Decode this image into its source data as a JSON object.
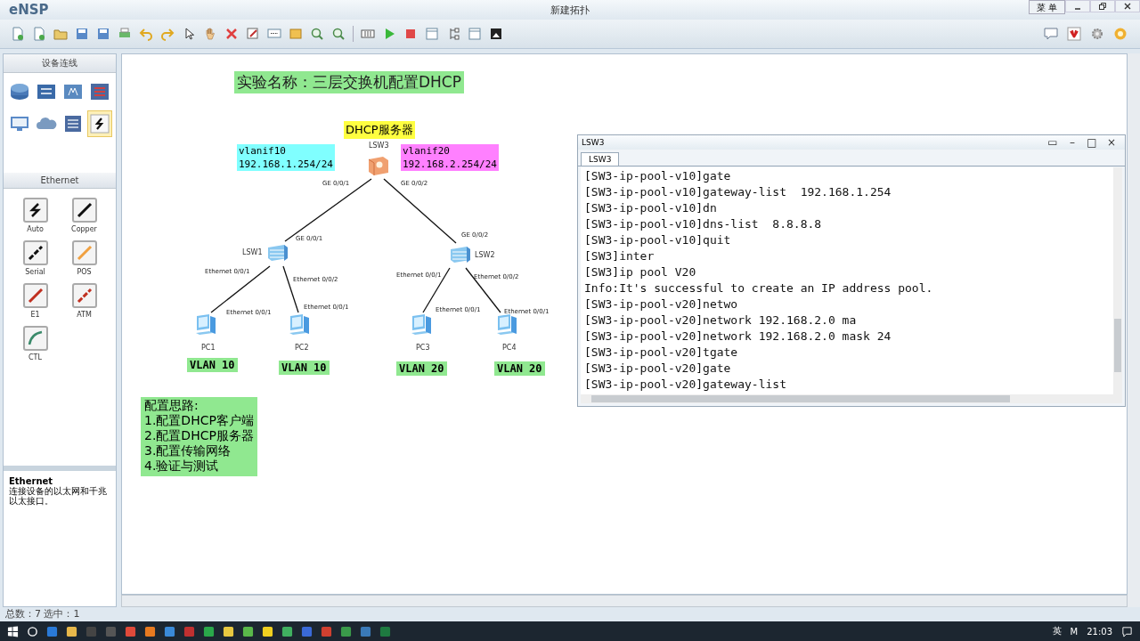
{
  "app": {
    "name": "eNSP",
    "title": "新建拓扑",
    "menu_button": "菜 单"
  },
  "palette": {
    "heading": "设备连线",
    "devices": [
      {
        "kind": "router",
        "selected": false
      },
      {
        "kind": "switch",
        "selected": false
      },
      {
        "kind": "wireless",
        "selected": false
      },
      {
        "kind": "firewall",
        "selected": false
      },
      {
        "kind": "pc",
        "selected": false
      },
      {
        "kind": "cloud",
        "selected": false
      },
      {
        "kind": "server",
        "selected": false
      },
      {
        "kind": "cable",
        "selected": true
      }
    ],
    "section": "Ethernet",
    "cables": [
      {
        "label": "Auto",
        "kind": "auto",
        "color": "#111111"
      },
      {
        "label": "Copper",
        "kind": "solid",
        "color": "#111111"
      },
      {
        "label": "Serial",
        "kind": "dashed",
        "color": "#111111"
      },
      {
        "label": "POS",
        "kind": "solid",
        "color": "#f0a040"
      },
      {
        "label": "E1",
        "kind": "solid",
        "color": "#c03020"
      },
      {
        "label": "ATM",
        "kind": "dashed",
        "color": "#c03020"
      },
      {
        "label": "CTL",
        "kind": "curve",
        "color": "#3a8a6a"
      }
    ],
    "info": {
      "title": "Ethernet",
      "text": "连接设备的以太网和千兆以太接口。"
    }
  },
  "canvas": {
    "title": "实验名称：三层交换机配置DHCP",
    "server_label": "DHCP服务器",
    "interfaces": [
      {
        "name": "vlanif10",
        "address": "192.168.1.254/24"
      },
      {
        "name": "vlanif20",
        "address": "192.168.2.254/24"
      }
    ],
    "devices": [
      {
        "label": "LSW3",
        "kind": "l3switch"
      },
      {
        "label": "LSW1",
        "kind": "switch"
      },
      {
        "label": "LSW2",
        "kind": "switch"
      },
      {
        "label": "PC1",
        "kind": "pc"
      },
      {
        "label": "PC2",
        "kind": "pc"
      },
      {
        "label": "PC3",
        "kind": "pc"
      },
      {
        "label": "PC4",
        "kind": "pc"
      }
    ],
    "ports": [
      "GE 0/0/1",
      "GE 0/0/2",
      "GE 0/0/1",
      "GE 0/0/2",
      "Ethernet 0/0/1",
      "Ethernet 0/0/2",
      "Ethernet 0/0/1",
      "Ethernet 0/0/1",
      "Ethernet 0/0/1",
      "Ethernet 0/0/2",
      "Ethernet 0/0/1",
      "Ethernet 0/0/1"
    ],
    "vlans": [
      "VLAN 10",
      "VLAN 10",
      "VLAN 20",
      "VLAN 20"
    ],
    "notes": [
      "配置思路:",
      "1.配置DHCP客户端",
      "2.配置DHCP服务器",
      "3.配置传输网络",
      "4.验证与测试"
    ]
  },
  "console": {
    "title": "LSW3",
    "controls": [
      "▭",
      "–",
      "□",
      "×"
    ],
    "tabs": [
      {
        "label": "LSW3",
        "selected": true
      }
    ],
    "lines": [
      "[SW3-ip-pool-v10]gate",
      "[SW3-ip-pool-v10]gateway-list  192.168.1.254",
      "[SW3-ip-pool-v10]dn",
      "[SW3-ip-pool-v10]dns-list  8.8.8.8",
      "[SW3-ip-pool-v10]quit",
      "[SW3]inter",
      "[SW3]ip pool V20",
      "Info:It's successful to create an IP address pool.",
      "[SW3-ip-pool-v20]netwo",
      "[SW3-ip-pool-v20]network 192.168.2.0 ma",
      "[SW3-ip-pool-v20]network 192.168.2.0 mask 24",
      "[SW3-ip-pool-v20]tgate",
      "[SW3-ip-pool-v20]gate",
      "[SW3-ip-pool-v20]gateway-list "
    ]
  },
  "status_bar": "总数：7 选中：1",
  "taskbar": {
    "tray": [
      "英",
      "M"
    ],
    "time": "21:03"
  }
}
